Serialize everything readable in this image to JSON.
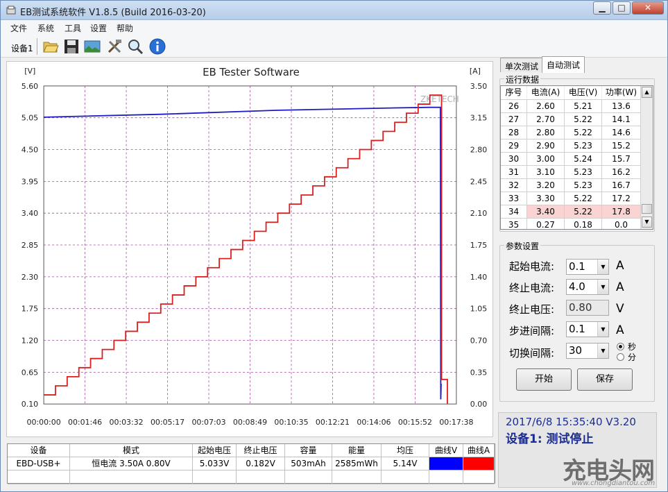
{
  "window": {
    "title": "EB测试系统软件 V1.8.5 (Build 2016-03-20)",
    "controls": {
      "minimize": "▁",
      "maximize": "□",
      "close": "✕"
    }
  },
  "menu": [
    "文件",
    "系统",
    "工具",
    "设置",
    "帮助"
  ],
  "toolbar": {
    "device_label": "设备1",
    "icons": [
      "open-folder-icon",
      "save-disk-icon",
      "picture-icon",
      "tools-icon",
      "search-icon",
      "info-icon"
    ]
  },
  "chart_data": {
    "type": "line",
    "title": "EB Tester Software",
    "watermark": "ZKETECH",
    "left_axis": {
      "unit": "[V]",
      "ticks": [
        "5.60",
        "5.05",
        "4.50",
        "3.95",
        "3.40",
        "2.85",
        "2.30",
        "1.75",
        "1.20",
        "0.65",
        "0.10"
      ],
      "range": [
        0.1,
        5.6
      ]
    },
    "right_axis": {
      "unit": "[A]",
      "ticks": [
        "3.50",
        "3.15",
        "2.80",
        "2.45",
        "2.10",
        "1.75",
        "1.40",
        "1.05",
        "0.70",
        "0.35",
        "0.00"
      ],
      "range": [
        0.0,
        3.5
      ]
    },
    "x_ticks": [
      "00:00:00",
      "00:01:46",
      "00:03:32",
      "00:05:17",
      "00:07:03",
      "00:08:49",
      "00:10:35",
      "00:12:21",
      "00:14:06",
      "00:15:52",
      "00:17:38"
    ],
    "x_range_seconds": [
      0,
      1058
    ],
    "step_seconds": 30,
    "series": [
      {
        "axis": "left",
        "color": "#1b1bc0",
        "x": [
          0,
          300,
          600,
          900,
          990,
          1017,
          1018,
          1019
        ],
        "y": [
          5.06,
          5.11,
          5.18,
          5.22,
          5.23,
          5.23,
          0.18,
          0.45
        ]
      },
      {
        "axis": "right",
        "color": "#d91e1e",
        "x": [
          0,
          30,
          60,
          90,
          120,
          150,
          180,
          210,
          240,
          270,
          300,
          330,
          360,
          390,
          420,
          450,
          480,
          510,
          540,
          570,
          600,
          630,
          660,
          690,
          720,
          750,
          780,
          810,
          840,
          870,
          900,
          930,
          960,
          990,
          1020,
          1035
        ],
        "y": [
          0.1,
          0.2,
          0.3,
          0.4,
          0.5,
          0.6,
          0.7,
          0.8,
          0.9,
          1.0,
          1.1,
          1.2,
          1.3,
          1.4,
          1.5,
          1.6,
          1.7,
          1.8,
          1.9,
          2.0,
          2.1,
          2.2,
          2.3,
          2.4,
          2.5,
          2.6,
          2.7,
          2.8,
          2.9,
          3.0,
          3.1,
          3.2,
          3.3,
          3.4,
          0.27,
          0.0
        ]
      }
    ]
  },
  "tabs": [
    "单次测试",
    "自动测试"
  ],
  "run_data": {
    "title": "运行数据",
    "columns": [
      "序号",
      "电流(A)",
      "电压(V)",
      "功率(W)"
    ],
    "rows": [
      [
        "26",
        "2.60",
        "5.21",
        "13.6"
      ],
      [
        "27",
        "2.70",
        "5.22",
        "14.1"
      ],
      [
        "28",
        "2.80",
        "5.22",
        "14.6"
      ],
      [
        "29",
        "2.90",
        "5.23",
        "15.2"
      ],
      [
        "30",
        "3.00",
        "5.24",
        "15.7"
      ],
      [
        "31",
        "3.10",
        "5.23",
        "16.2"
      ],
      [
        "32",
        "3.20",
        "5.23",
        "16.7"
      ],
      [
        "33",
        "3.30",
        "5.22",
        "17.2"
      ],
      [
        "34",
        "3.40",
        "5.22",
        "17.8"
      ],
      [
        "35",
        "0.27",
        "0.18",
        "0.0"
      ]
    ],
    "selected_row": 8
  },
  "params": {
    "title": "参数设置",
    "start_current": {
      "label": "起始电流:",
      "value": "0.1",
      "unit": "A"
    },
    "end_current": {
      "label": "终止电流:",
      "value": "4.0",
      "unit": "A"
    },
    "end_voltage": {
      "label": "终止电压:",
      "value": "0.80",
      "unit": "V"
    },
    "step_interval": {
      "label": "步进间隔:",
      "value": "0.1",
      "unit": "A"
    },
    "switch_interval": {
      "label": "切换间隔:",
      "value": "30"
    },
    "time_unit_options": [
      "秒",
      "分"
    ],
    "time_unit_selected": "秒",
    "start_button": "开始",
    "save_button": "保存"
  },
  "status": {
    "line1": "2017/6/8 15:35:40  V3.20",
    "line2": "设备1: 测试停止"
  },
  "summary": {
    "headers": [
      "设备",
      "模式",
      "起始电压",
      "终止电压",
      "容量",
      "能量",
      "均压",
      "曲线V",
      "曲线A"
    ],
    "row": [
      "EBD-USB+",
      "恒电流  3.50A  0.80V",
      "5.033V",
      "0.182V",
      "503mAh",
      "2585mWh",
      "5.14V"
    ],
    "curve_v_color": "#0000ff",
    "curve_a_color": "#ff0000"
  },
  "watermark": {
    "logo": "充电头网",
    "url": "www.chongdiantou.com"
  }
}
